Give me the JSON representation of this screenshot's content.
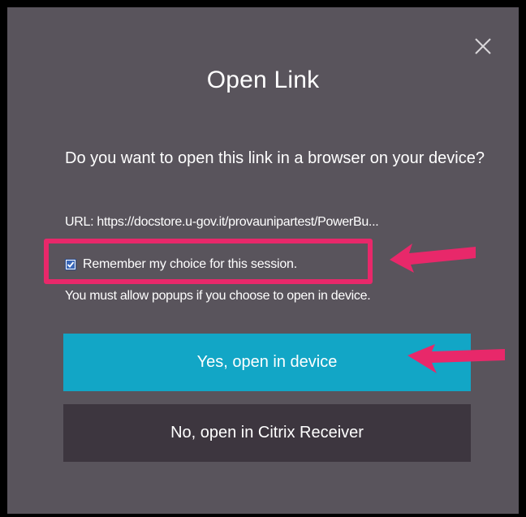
{
  "dialog": {
    "title": "Open Link",
    "close_icon": "close-icon",
    "question": "Do you want to open this link in a browser on your device?",
    "url_line": "URL: https://docstore.u-gov.it/provaunipartest/PowerBu...",
    "remember": {
      "label": "Remember my choice for this session.",
      "checked": true
    },
    "popups_note": "You must allow popups if you choose to open in device.",
    "yes_button": "Yes, open in device",
    "no_button": "No, open in Citrix Receiver"
  },
  "annotations": {
    "highlight_color": "#e8286a",
    "arrow_color": "#e8286a"
  },
  "colors": {
    "dialog_bg": "#59545c",
    "primary_button": "#12a6c6",
    "secondary_button": "#3d363f"
  }
}
